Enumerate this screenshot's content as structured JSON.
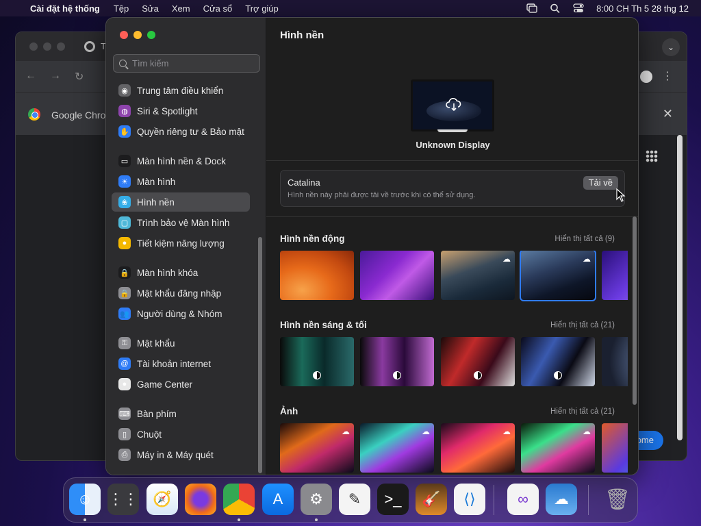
{
  "menubar": {
    "apple_glyph": "",
    "app_name": "Cài đặt hệ thống",
    "menus": [
      "Tệp",
      "Sửa",
      "Xem",
      "Cửa sổ",
      "Trợ giúp"
    ],
    "clock": "8:00 CH Th 5 28 thg 12"
  },
  "chrome": {
    "tab_title": "T",
    "banner_title": "Google Chron",
    "home_button": "ome",
    "close_glyph": "✕",
    "expand_glyph": "⌄",
    "back_glyph": "←",
    "forward_glyph": "→",
    "reload_glyph": "↻",
    "kebab_glyph": "⋮"
  },
  "settings": {
    "search_placeholder": "Tìm kiếm",
    "sidebar": {
      "items": [
        {
          "label": "Trung tâm điều khiển",
          "icon": "control-center-icon",
          "color": "#636366"
        },
        {
          "label": "Siri & Spotlight",
          "icon": "siri-icon",
          "color": "#8e44ad"
        },
        {
          "label": "Quyền riêng tư & Bảo mật",
          "icon": "hand-icon",
          "color": "#2f7cf6"
        },
        {
          "label": "Màn hình nền & Dock",
          "icon": "dock-icon",
          "color": "#1c1c1e"
        },
        {
          "label": "Màn hình",
          "icon": "display-brightness-icon",
          "color": "#2f7cf6"
        },
        {
          "label": "Hình nền",
          "icon": "wallpaper-icon",
          "color": "#35aee8"
        },
        {
          "label": "Trình bảo vệ Màn hình",
          "icon": "screensaver-icon",
          "color": "#4fb8d8"
        },
        {
          "label": "Tiết kiệm năng lượng",
          "icon": "bulb-icon",
          "color": "#f5b800"
        },
        {
          "label": "Màn hình khóa",
          "icon": "lock-icon",
          "color": "#1c1c1e"
        },
        {
          "label": "Mật khẩu đăng nhập",
          "icon": "lock-icon",
          "color": "#8e8e93"
        },
        {
          "label": "Người dùng & Nhóm",
          "icon": "users-icon",
          "color": "#2f7cf6"
        },
        {
          "label": "Mật khẩu",
          "icon": "key-icon",
          "color": "#8e8e93"
        },
        {
          "label": "Tài khoản internet",
          "icon": "at-icon",
          "color": "#2f7cf6"
        },
        {
          "label": "Game Center",
          "icon": "game-center-icon",
          "color": "#e8e8e8"
        },
        {
          "label": "Bàn phím",
          "icon": "keyboard-icon",
          "color": "#8e8e93"
        },
        {
          "label": "Chuột",
          "icon": "mouse-icon",
          "color": "#8e8e93"
        },
        {
          "label": "Máy in & Máy quét",
          "icon": "printer-icon",
          "color": "#8e8e93"
        }
      ],
      "active_index": 5
    },
    "content": {
      "title": "Hình nền",
      "display_name": "Unknown Display",
      "current_wallpaper": {
        "name": "Catalina",
        "description": "Hình nền này phải được tải về trước khi có thể sử dụng.",
        "download_label": "Tải về"
      },
      "sections": [
        {
          "title": "Hình nền động",
          "link": "Hiển thị tất cả (9)"
        },
        {
          "title": "Hình nền sáng & tối",
          "link": "Hiển thị tất cả (21)"
        },
        {
          "title": "Ảnh",
          "link": "Hiển thị tất cả (21)"
        }
      ]
    }
  },
  "dock": {
    "apps": [
      "Finder",
      "Launchpad",
      "Safari",
      "Firefox",
      "Google Chrome",
      "App Store",
      "Cài đặt hệ thống",
      "TextEdit",
      "Terminal",
      "GarageBand",
      "Visual Studio Code",
      "Visual Studio",
      "Weather",
      "Thùng rác"
    ]
  }
}
